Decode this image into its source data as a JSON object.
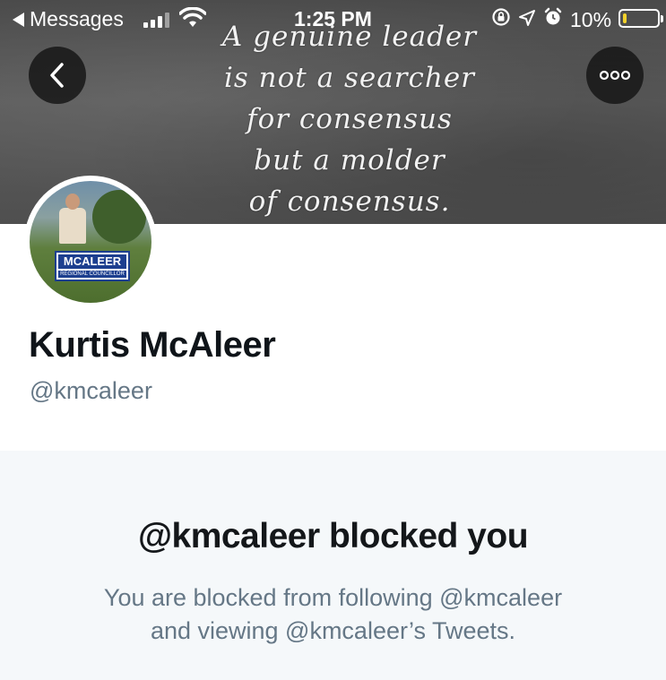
{
  "status_bar": {
    "back_app": "Messages",
    "time": "1:25 PM",
    "battery": "10%",
    "battery_level": 0.1
  },
  "banner": {
    "quote_lines": [
      "A genuine leader",
      "is not a searcher",
      "for consensus",
      "but a molder",
      "of consensus."
    ]
  },
  "avatar_sign": {
    "name": "MCALEER",
    "subtitle": "REGIONAL COUNCILLOR"
  },
  "profile": {
    "name": "Kurtis McAleer",
    "handle": "@kmcaleer"
  },
  "blocked": {
    "title": "@kmcaleer blocked you",
    "message_line1": "You are blocked from following @kmcaleer",
    "message_line2": "and viewing @kmcaleer’s Tweets."
  },
  "colors": {
    "banner_overlay_button": "#141414",
    "secondary_text": "#657786",
    "panel_bg": "#f5f8fa",
    "sign_blue": "#1d3f8f"
  }
}
